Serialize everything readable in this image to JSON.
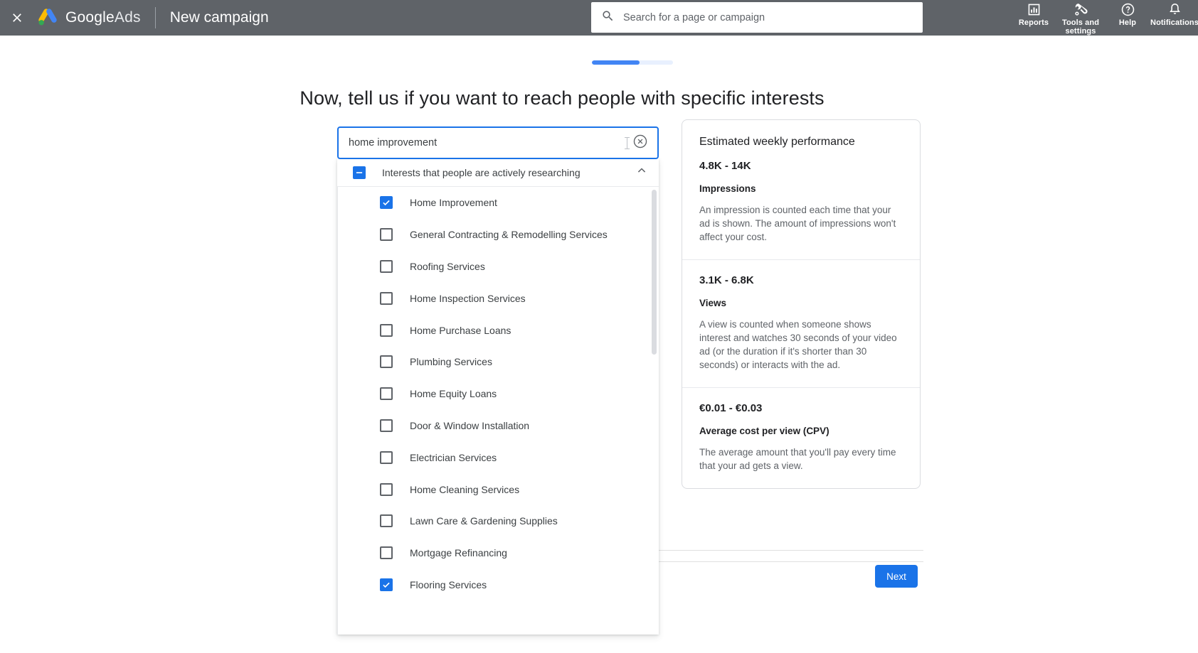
{
  "header": {
    "close_icon": "close-icon",
    "brand_google": "Google",
    "brand_ads": "Ads",
    "campaign_title": "New campaign",
    "search": {
      "placeholder": "Search for a page or campaign",
      "value": "",
      "icon": "search-icon"
    },
    "actions": [
      {
        "label": "Reports",
        "icon": "reports-bar-chart-icon"
      },
      {
        "label": "Tools and settings",
        "icon": "wrench-tools-icon"
      },
      {
        "label": "Help",
        "icon": "help-question-circle-icon"
      },
      {
        "label": "Notifications",
        "icon": "bell-notification-icon"
      }
    ]
  },
  "progress": {
    "percent": 59,
    "fill_color": "#4285f4",
    "track_color": "#e8f0fe"
  },
  "page": {
    "heading": "Now, tell us if you want to reach people with specific interests"
  },
  "interest_picker": {
    "search_value": "home improvement",
    "clear_icon": "clear-circle-x-icon",
    "group": {
      "label": "Interests that people are actively researching",
      "checkbox_state": "indeterminate",
      "collapse_icon": "chevron-up-icon"
    },
    "options": [
      {
        "label": "Home Improvement",
        "checked": true
      },
      {
        "label": "General Contracting & Remodelling Services",
        "checked": false
      },
      {
        "label": "Roofing Services",
        "checked": false
      },
      {
        "label": "Home Inspection Services",
        "checked": false
      },
      {
        "label": "Home Purchase Loans",
        "checked": false
      },
      {
        "label": "Plumbing Services",
        "checked": false
      },
      {
        "label": "Home Equity Loans",
        "checked": false
      },
      {
        "label": "Door & Window Installation",
        "checked": false
      },
      {
        "label": "Electrician Services",
        "checked": false
      },
      {
        "label": "Home Cleaning Services",
        "checked": false
      },
      {
        "label": "Lawn Care & Gardening Supplies",
        "checked": false
      },
      {
        "label": "Mortgage Refinancing",
        "checked": false
      },
      {
        "label": "Flooring Services",
        "checked": true
      }
    ]
  },
  "estimates": {
    "title": "Estimated weekly performance",
    "metrics": [
      {
        "value": "4.8K - 14K",
        "name": "Impressions",
        "description": "An impression is counted each time that your ad is shown. The amount of impressions won't affect your cost."
      },
      {
        "value": "3.1K - 6.8K",
        "name": "Views",
        "description": "A view is counted when someone shows interest and watches 30 seconds of your video ad (or the duration if it's shorter than 30 seconds) or interacts with the ad."
      },
      {
        "value": "€0.01 - €0.03",
        "name": "Average cost per view (CPV)",
        "description": "The average amount that you'll pay every time that your ad gets a view."
      }
    ]
  },
  "footer": {
    "next_label": "Next",
    "next_color": "#1a73e8"
  }
}
